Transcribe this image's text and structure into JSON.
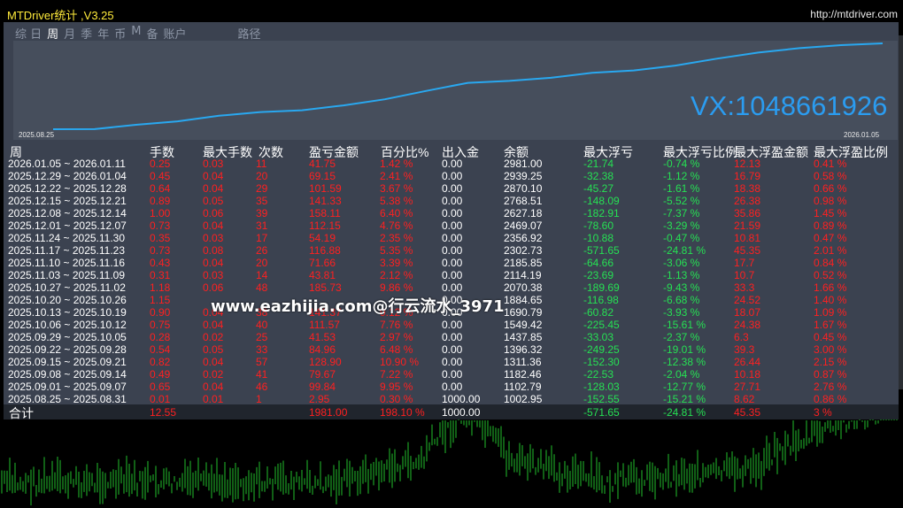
{
  "window": {
    "title": "MTDriver统计 ,V3.25",
    "url": "http://mtdriver.com"
  },
  "tabs": [
    {
      "label": "综 日",
      "active": false
    },
    {
      "label": "周",
      "active": true
    },
    {
      "label": "月",
      "active": false
    },
    {
      "label": "季",
      "active": false
    },
    {
      "label": "年",
      "active": false
    },
    {
      "label": "币",
      "active": false
    },
    {
      "label": "M",
      "active": false
    },
    {
      "label": "备",
      "active": false
    },
    {
      "label": "账户",
      "active": false
    },
    {
      "label": "路径",
      "active": false
    }
  ],
  "equity_chart": {
    "start_label": "2025.08.25",
    "end_label": "2026.01.05",
    "line_color": "#29a8f0",
    "values": [
      0,
      2.95,
      102.79,
      182.46,
      311.36,
      396.32,
      437.85,
      549.42,
      690.79,
      884.65,
      1070.38,
      1114.19,
      1185.65,
      1302.73,
      1356.92,
      1469.07,
      1627.18,
      1768.51,
      1870.1,
      1939.25,
      1981.0
    ]
  },
  "watermark": "VX:1048661926",
  "overlay_text": "www.eazhijia.com@行云流水_3971",
  "table": {
    "headers": [
      "周",
      "手数",
      "最大手数",
      "次数",
      "盈亏金额",
      "百分比%",
      "出入金",
      "余额",
      "最大浮亏",
      "最大浮亏比例",
      "最大浮盈金额",
      "最大浮盈比例"
    ],
    "rows": [
      [
        "2026.01.05 ~ 2026.01.11",
        "0.25",
        "0.03",
        "11",
        "41.75",
        "1.42 %",
        "0.00",
        "2981.00",
        "-21.74",
        "-0.74 %",
        "12.13",
        "0.41 %"
      ],
      [
        "2025.12.29 ~ 2026.01.04",
        "0.45",
        "0.04",
        "20",
        "69.15",
        "2.41 %",
        "0.00",
        "2939.25",
        "-32.38",
        "-1.12 %",
        "16.79",
        "0.58 %"
      ],
      [
        "2025.12.22 ~ 2025.12.28",
        "0.64",
        "0.04",
        "29",
        "101.59",
        "3.67 %",
        "0.00",
        "2870.10",
        "-45.27",
        "-1.61 %",
        "18.38",
        "0.66 %"
      ],
      [
        "2025.12.15 ~ 2025.12.21",
        "0.89",
        "0.05",
        "35",
        "141.33",
        "5.38 %",
        "0.00",
        "2768.51",
        "-148.09",
        "-5.52 %",
        "26.38",
        "0.98 %"
      ],
      [
        "2025.12.08 ~ 2025.12.14",
        "1.00",
        "0.06",
        "39",
        "158.11",
        "6.40 %",
        "0.00",
        "2627.18",
        "-182.91",
        "-7.37 %",
        "35.86",
        "1.45 %"
      ],
      [
        "2025.12.01 ~ 2025.12.07",
        "0.73",
        "0.04",
        "31",
        "112.15",
        "4.76 %",
        "0.00",
        "2469.07",
        "-78.60",
        "-3.29 %",
        "21.59",
        "0.89 %"
      ],
      [
        "2025.11.24 ~ 2025.11.30",
        "0.35",
        "0.03",
        "17",
        "54.19",
        "2.35 %",
        "0.00",
        "2356.92",
        "-10.88",
        "-0.47 %",
        "10.81",
        "0.47 %"
      ],
      [
        "2025.11.17 ~ 2025.11.23",
        "0.73",
        "0.08",
        "26",
        "116.88",
        "5.35 %",
        "0.00",
        "2302.73",
        "-571.65",
        "-24.81 %",
        "45.35",
        "2.01 %"
      ],
      [
        "2025.11.10 ~ 2025.11.16",
        "0.43",
        "0.04",
        "20",
        "71.66",
        "3.39 %",
        "0.00",
        "2185.85",
        "-64.66",
        "-3.06 %",
        "17.7",
        "0.84 %"
      ],
      [
        "2025.11.03 ~ 2025.11.09",
        "0.31",
        "0.03",
        "14",
        "43.81",
        "2.12 %",
        "0.00",
        "2114.19",
        "-23.69",
        "-1.13 %",
        "10.7",
        "0.52 %"
      ],
      [
        "2025.10.27 ~ 2025.11.02",
        "1.18",
        "0.06",
        "48",
        "185.73",
        "9.86 %",
        "0.00",
        "2070.38",
        "-189.69",
        "-9.43 %",
        "33.3",
        "1.66 %"
      ],
      [
        "2025.10.20 ~ 2025.10.26",
        "1.15",
        "",
        "",
        "",
        "",
        "0.00",
        "1884.65",
        "-116.98",
        "-6.68 %",
        "24.52",
        "1.40 %"
      ],
      [
        "2025.10.13 ~ 2025.10.19",
        "0.90",
        "0.04",
        "38",
        "141.37",
        "9.12 %",
        "0.00",
        "1690.79",
        "-60.82",
        "-3.93 %",
        "18.07",
        "1.09 %"
      ],
      [
        "2025.10.06 ~ 2025.10.12",
        "0.75",
        "0.04",
        "40",
        "111.57",
        "7.76 %",
        "0.00",
        "1549.42",
        "-225.45",
        "-15.61 %",
        "24.38",
        "1.67 %"
      ],
      [
        "2025.09.29 ~ 2025.10.05",
        "0.28",
        "0.02",
        "25",
        "41.53",
        "2.97 %",
        "0.00",
        "1437.85",
        "-33.03",
        "-2.37 %",
        "6.3",
        "0.45 %"
      ],
      [
        "2025.09.22 ~ 2025.09.28",
        "0.54",
        "0.05",
        "33",
        "84.96",
        "6.48 %",
        "0.00",
        "1396.32",
        "-249.25",
        "-19.01 %",
        "39.3",
        "3.00 %"
      ],
      [
        "2025.09.15 ~ 2025.09.21",
        "0.82",
        "0.04",
        "57",
        "128.90",
        "10.90 %",
        "0.00",
        "1311.36",
        "-152.30",
        "-12.38 %",
        "26.44",
        "2.15 %"
      ],
      [
        "2025.09.08 ~ 2025.09.14",
        "0.49",
        "0.02",
        "41",
        "79.67",
        "7.22 %",
        "0.00",
        "1182.46",
        "-22.53",
        "-2.04 %",
        "10.18",
        "0.87 %"
      ],
      [
        "2025.09.01 ~ 2025.09.07",
        "0.65",
        "0.04",
        "46",
        "99.84",
        "9.95 %",
        "0.00",
        "1102.79",
        "-128.03",
        "-12.77 %",
        "27.71",
        "2.76 %"
      ],
      [
        "2025.08.25 ~ 2025.08.31",
        "0.01",
        "0.01",
        "1",
        "2.95",
        "0.30 %",
        "1000.00",
        "1002.95",
        "-152.55",
        "-15.21 %",
        "8.62",
        "0.86 %"
      ]
    ],
    "total": [
      "合计",
      "12.55",
      "",
      "",
      "1981.00",
      "198.10 %",
      "1000.00",
      "",
      "-571.65",
      "-24.81 %",
      "45.35",
      "3 %"
    ]
  },
  "colors": {
    "panel_bg": "#3b4250",
    "profit": "#ff2020",
    "loss": "#26e053",
    "title": "#ffeb3b",
    "candle": "#22c02c"
  }
}
